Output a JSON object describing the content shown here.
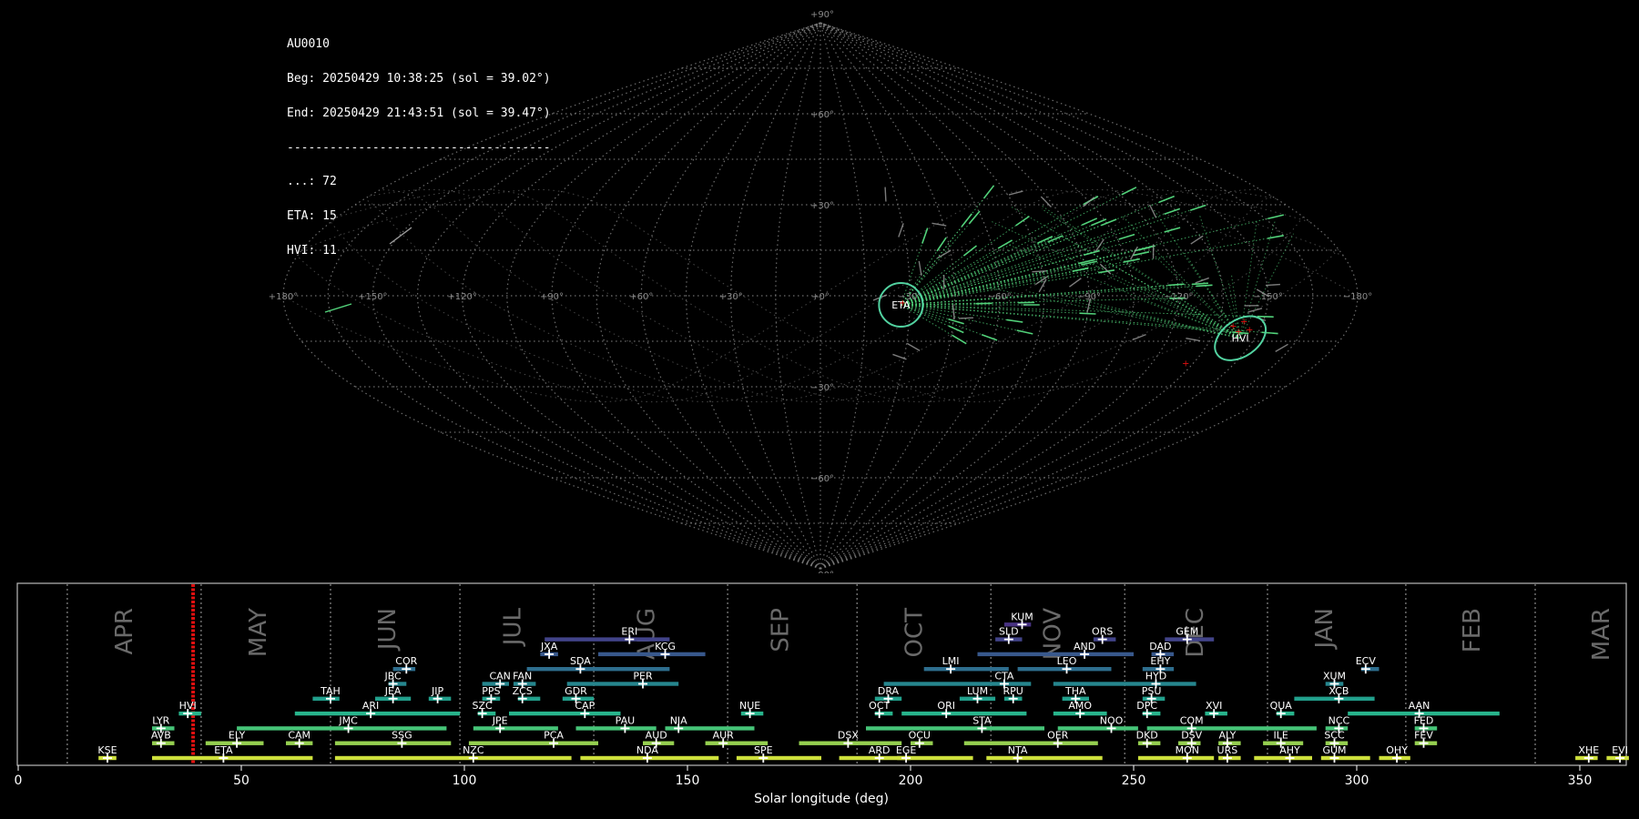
{
  "info": {
    "lines": [
      "AU0010",
      "Beg: 20250429 10:38:25 (sol = 39.02°)",
      "End: 20250429 21:43:51 (sol = 39.47°)",
      "-------------------------------------",
      "...: 72",
      "ETA: 15",
      "HVI: 11"
    ]
  },
  "colors": {
    "background": "#000000",
    "grid": "#7f7f7f",
    "meteor_green": "#52d27a",
    "meteor_gray": "#9a9a9a",
    "radiant_circle": "#52d2a0",
    "sol_marker": "#e01010"
  },
  "chart_data": [
    {
      "type": "scatter",
      "projection": "sinusoidal",
      "lon_tick_labels": [
        "+180°",
        "+150°",
        "+120°",
        "+90°",
        "+60°",
        "+30°",
        "+0°",
        "−30°",
        "−60°",
        "−90°",
        "−120°",
        "−150°",
        "−180°"
      ],
      "lat_tick_labels": [
        "+90°",
        "+60°",
        "+30°",
        "−30°",
        "−60°",
        "−90°"
      ],
      "radiants": [
        {
          "name": "ETA",
          "lon": -27,
          "lat": -3
        },
        {
          "name": "HVI",
          "lon": -145,
          "lat": -14
        }
      ],
      "grid": true
    },
    {
      "type": "bar",
      "xlabel": "Solar longitude (deg)",
      "xlim": [
        0,
        360
      ],
      "x_ticks": [
        0,
        50,
        100,
        150,
        200,
        250,
        300,
        350
      ],
      "current_sol": 39.2,
      "months": [
        {
          "name": "APR",
          "start": 11,
          "label": 24
        },
        {
          "name": "MAY",
          "start": 41,
          "label": 54
        },
        {
          "name": "JUN",
          "start": 70,
          "label": 83
        },
        {
          "name": "JUL",
          "start": 99,
          "label": 111
        },
        {
          "name": "AUG",
          "start": 129,
          "label": 141
        },
        {
          "name": "SEP",
          "start": 159,
          "label": 171
        },
        {
          "name": "OCT",
          "start": 188,
          "label": 201
        },
        {
          "name": "NOV",
          "start": 218,
          "label": 232
        },
        {
          "name": "DEC",
          "start": 248,
          "label": 264
        },
        {
          "name": "JAN",
          "start": 280,
          "label": 293
        },
        {
          "name": "FEB",
          "start": 311,
          "label": 326
        },
        {
          "name": "MAR",
          "start": 340,
          "label": 355
        }
      ],
      "showers": [
        {
          "code": "KUM",
          "start": 221,
          "end": 227,
          "peak": 225,
          "row": 10
        },
        {
          "code": "ERI",
          "start": 118,
          "end": 146,
          "peak": 137,
          "row": 9
        },
        {
          "code": "SLD",
          "start": 219,
          "end": 225,
          "peak": 222,
          "row": 9
        },
        {
          "code": "ORS",
          "start": 241,
          "end": 246,
          "peak": 243,
          "row": 9
        },
        {
          "code": "GEM",
          "start": 257,
          "end": 268,
          "peak": 262,
          "row": 9
        },
        {
          "code": "JXA",
          "start": 117,
          "end": 121,
          "peak": 119,
          "row": 8
        },
        {
          "code": "KCG",
          "start": 130,
          "end": 154,
          "peak": 145,
          "row": 8
        },
        {
          "code": "AND",
          "start": 215,
          "end": 250,
          "peak": 239,
          "row": 8
        },
        {
          "code": "DAD",
          "start": 254,
          "end": 259,
          "peak": 256,
          "row": 8
        },
        {
          "code": "COR",
          "start": 84,
          "end": 89,
          "peak": 87,
          "row": 7
        },
        {
          "code": "SDA",
          "start": 114,
          "end": 146,
          "peak": 126,
          "row": 7
        },
        {
          "code": "LMI",
          "start": 203,
          "end": 222,
          "peak": 209,
          "row": 7
        },
        {
          "code": "LEO",
          "start": 224,
          "end": 245,
          "peak": 235,
          "row": 7
        },
        {
          "code": "EHY",
          "start": 252,
          "end": 259,
          "peak": 256,
          "row": 7
        },
        {
          "code": "ECV",
          "start": 301,
          "end": 305,
          "peak": 302,
          "row": 7
        },
        {
          "code": "JBC",
          "start": 83,
          "end": 87,
          "peak": 84,
          "row": 6
        },
        {
          "code": "CAN",
          "start": 104,
          "end": 110,
          "peak": 108,
          "row": 6
        },
        {
          "code": "FAN",
          "start": 111,
          "end": 116,
          "peak": 113,
          "row": 6
        },
        {
          "code": "PER",
          "start": 123,
          "end": 148,
          "peak": 140,
          "row": 6
        },
        {
          "code": "CTA",
          "start": 194,
          "end": 227,
          "peak": 221,
          "row": 6
        },
        {
          "code": "HYD",
          "start": 232,
          "end": 264,
          "peak": 255,
          "row": 6
        },
        {
          "code": "XUM",
          "start": 293,
          "end": 297,
          "peak": 295,
          "row": 6
        },
        {
          "code": "TAH",
          "start": 66,
          "end": 72,
          "peak": 70,
          "row": 5
        },
        {
          "code": "JEA",
          "start": 80,
          "end": 88,
          "peak": 84,
          "row": 5
        },
        {
          "code": "JIP",
          "start": 92,
          "end": 97,
          "peak": 94,
          "row": 5
        },
        {
          "code": "PPS",
          "start": 104,
          "end": 108,
          "peak": 106,
          "row": 5
        },
        {
          "code": "ZCS",
          "start": 112,
          "end": 117,
          "peak": 113,
          "row": 5
        },
        {
          "code": "GDR",
          "start": 122,
          "end": 129,
          "peak": 125,
          "row": 5
        },
        {
          "code": "DRA",
          "start": 192,
          "end": 198,
          "peak": 195,
          "row": 5
        },
        {
          "code": "LUM",
          "start": 211,
          "end": 219,
          "peak": 215,
          "row": 5
        },
        {
          "code": "RPU",
          "start": 221,
          "end": 225,
          "peak": 223,
          "row": 5
        },
        {
          "code": "THA",
          "start": 234,
          "end": 240,
          "peak": 237,
          "row": 5
        },
        {
          "code": "PSU",
          "start": 252,
          "end": 257,
          "peak": 254,
          "row": 5
        },
        {
          "code": "XCB",
          "start": 286,
          "end": 304,
          "peak": 296,
          "row": 5
        },
        {
          "code": "HVI",
          "start": 36,
          "end": 41,
          "peak": 38,
          "row": 4
        },
        {
          "code": "ARI",
          "start": 62,
          "end": 99,
          "peak": 79,
          "row": 4
        },
        {
          "code": "SZC",
          "start": 103,
          "end": 107,
          "peak": 104,
          "row": 4
        },
        {
          "code": "CAP",
          "start": 110,
          "end": 135,
          "peak": 127,
          "row": 4
        },
        {
          "code": "NUE",
          "start": 162,
          "end": 167,
          "peak": 164,
          "row": 4
        },
        {
          "code": "OCT",
          "start": 192,
          "end": 196,
          "peak": 193,
          "row": 4
        },
        {
          "code": "ORI",
          "start": 198,
          "end": 226,
          "peak": 208,
          "row": 4
        },
        {
          "code": "AMO",
          "start": 232,
          "end": 244,
          "peak": 238,
          "row": 4
        },
        {
          "code": "DPC",
          "start": 252,
          "end": 256,
          "peak": 253,
          "row": 4
        },
        {
          "code": "XVI",
          "start": 266,
          "end": 271,
          "peak": 268,
          "row": 4
        },
        {
          "code": "QUA",
          "start": 282,
          "end": 286,
          "peak": 283,
          "row": 4
        },
        {
          "code": "AAN",
          "start": 298,
          "end": 332,
          "peak": 314,
          "row": 4
        },
        {
          "code": "LYR",
          "start": 30,
          "end": 35,
          "peak": 32,
          "row": 3
        },
        {
          "code": "JMC",
          "start": 49,
          "end": 96,
          "peak": 74,
          "row": 3
        },
        {
          "code": "JPE",
          "start": 102,
          "end": 121,
          "peak": 108,
          "row": 3
        },
        {
          "code": "PAU",
          "start": 125,
          "end": 143,
          "peak": 136,
          "row": 3
        },
        {
          "code": "NIA",
          "start": 145,
          "end": 165,
          "peak": 148,
          "row": 3
        },
        {
          "code": "STA",
          "start": 190,
          "end": 230,
          "peak": 216,
          "row": 3
        },
        {
          "code": "NOO",
          "start": 233,
          "end": 251,
          "peak": 245,
          "row": 3
        },
        {
          "code": "COM",
          "start": 253,
          "end": 291,
          "peak": 263,
          "row": 3
        },
        {
          "code": "NCC",
          "start": 293,
          "end": 298,
          "peak": 296,
          "row": 3
        },
        {
          "code": "FED",
          "start": 313,
          "end": 318,
          "peak": 315,
          "row": 3
        },
        {
          "code": "AVB",
          "start": 30,
          "end": 35,
          "peak": 32,
          "row": 2
        },
        {
          "code": "ELY",
          "start": 42,
          "end": 55,
          "peak": 49,
          "row": 2
        },
        {
          "code": "CAM",
          "start": 60,
          "end": 66,
          "peak": 63,
          "row": 2
        },
        {
          "code": "SSG",
          "start": 71,
          "end": 97,
          "peak": 86,
          "row": 2
        },
        {
          "code": "PCA",
          "start": 101,
          "end": 130,
          "peak": 120,
          "row": 2
        },
        {
          "code": "AUD",
          "start": 140,
          "end": 147,
          "peak": 143,
          "row": 2
        },
        {
          "code": "AUR",
          "start": 154,
          "end": 168,
          "peak": 158,
          "row": 2
        },
        {
          "code": "DSX",
          "start": 175,
          "end": 198,
          "peak": 186,
          "row": 2
        },
        {
          "code": "OCU",
          "start": 200,
          "end": 205,
          "peak": 202,
          "row": 2
        },
        {
          "code": "OER",
          "start": 212,
          "end": 242,
          "peak": 233,
          "row": 2
        },
        {
          "code": "DKD",
          "start": 251,
          "end": 256,
          "peak": 253,
          "row": 2
        },
        {
          "code": "DSV",
          "start": 260,
          "end": 265,
          "peak": 263,
          "row": 2
        },
        {
          "code": "ALY",
          "start": 269,
          "end": 274,
          "peak": 271,
          "row": 2
        },
        {
          "code": "ILE",
          "start": 279,
          "end": 288,
          "peak": 283,
          "row": 2
        },
        {
          "code": "SCC",
          "start": 293,
          "end": 298,
          "peak": 295,
          "row": 2
        },
        {
          "code": "FEV",
          "start": 313,
          "end": 318,
          "peak": 315,
          "row": 2
        },
        {
          "code": "KSE",
          "start": 18,
          "end": 22,
          "peak": 20,
          "row": 1
        },
        {
          "code": "ETA",
          "start": 30,
          "end": 66,
          "peak": 46,
          "row": 1
        },
        {
          "code": "NZC",
          "start": 71,
          "end": 124,
          "peak": 102,
          "row": 1
        },
        {
          "code": "NDA",
          "start": 126,
          "end": 157,
          "peak": 141,
          "row": 1
        },
        {
          "code": "SPE",
          "start": 161,
          "end": 180,
          "peak": 167,
          "row": 1
        },
        {
          "code": "ARD",
          "start": 184,
          "end": 200,
          "peak": 193,
          "row": 1
        },
        {
          "code": "EGE",
          "start": 197,
          "end": 214,
          "peak": 199,
          "row": 1
        },
        {
          "code": "NTA",
          "start": 217,
          "end": 243,
          "peak": 224,
          "row": 1
        },
        {
          "code": "MON",
          "start": 251,
          "end": 268,
          "peak": 262,
          "row": 1
        },
        {
          "code": "URS",
          "start": 269,
          "end": 274,
          "peak": 271,
          "row": 1
        },
        {
          "code": "AHY",
          "start": 277,
          "end": 290,
          "peak": 285,
          "row": 1
        },
        {
          "code": "GUM",
          "start": 292,
          "end": 303,
          "peak": 295,
          "row": 1
        },
        {
          "code": "OHY",
          "start": 305,
          "end": 312,
          "peak": 309,
          "row": 1
        },
        {
          "code": "XHE",
          "start": 349,
          "end": 354,
          "peak": 352,
          "row": 1
        },
        {
          "code": "EVI",
          "start": 356,
          "end": 361,
          "peak": 359,
          "row": 1
        }
      ]
    }
  ]
}
